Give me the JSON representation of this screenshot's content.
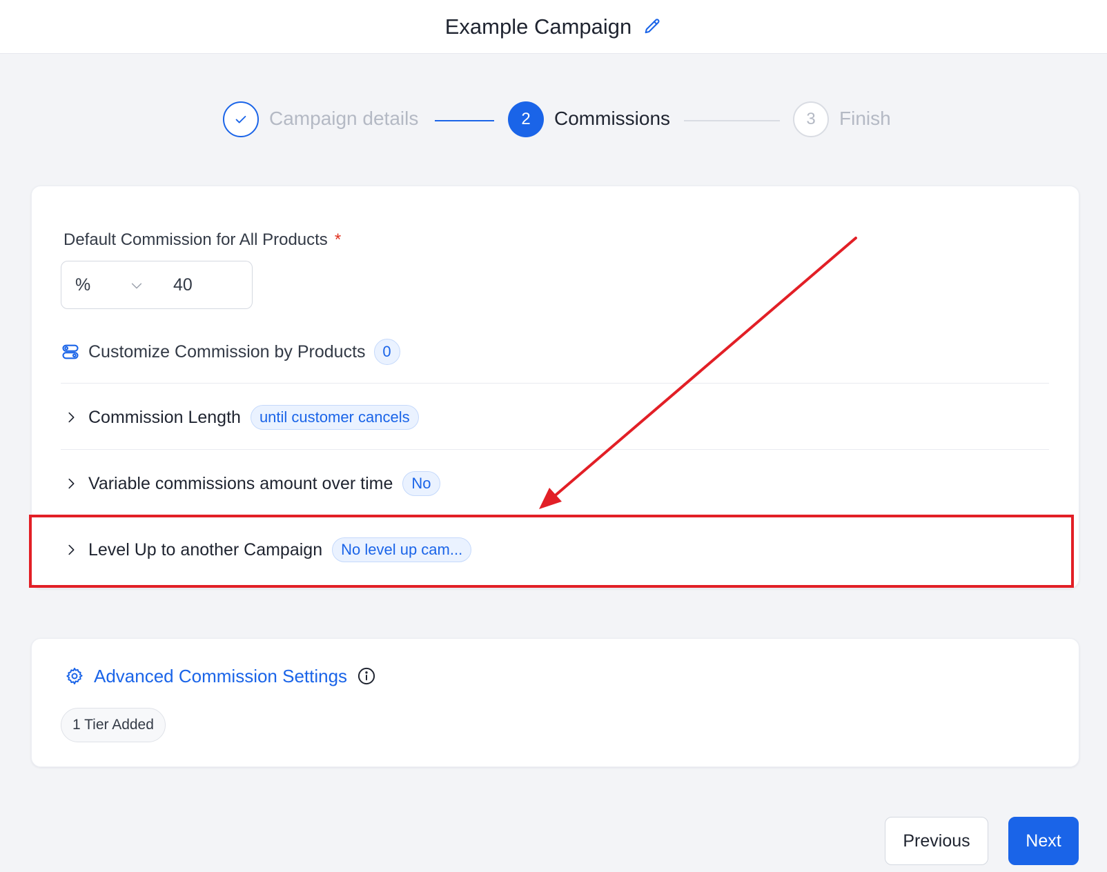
{
  "header": {
    "title": "Example Campaign",
    "edit_icon": "pencil-icon"
  },
  "stepper": {
    "steps": [
      {
        "number": "✓",
        "label": "Campaign details",
        "state": "completed"
      },
      {
        "number": "2",
        "label": "Commissions",
        "state": "active"
      },
      {
        "number": "3",
        "label": "Finish",
        "state": "upcoming"
      }
    ]
  },
  "commission": {
    "label": "Default Commission for All Products",
    "required_mark": "*",
    "unit": "%",
    "amount": "40"
  },
  "customize": {
    "icon": "toggles-icon",
    "label": "Customize Commission by Products",
    "count": "0"
  },
  "sections": [
    {
      "title": "Commission Length",
      "badge": "until customer cancels"
    },
    {
      "title": "Variable commissions amount over time",
      "badge": "No"
    },
    {
      "title": "Level Up to another Campaign",
      "badge": "No level up cam..."
    }
  ],
  "advanced": {
    "title": "Advanced Commission Settings",
    "icon": "gear-icon",
    "info_icon": "info-icon",
    "tier_chip": "1 Tier Added"
  },
  "footer": {
    "previous_label": "Previous",
    "next_label": "Next"
  },
  "colors": {
    "accent": "#1a64e8",
    "annotation": "#e21f26",
    "background": "#f3f4f7"
  }
}
